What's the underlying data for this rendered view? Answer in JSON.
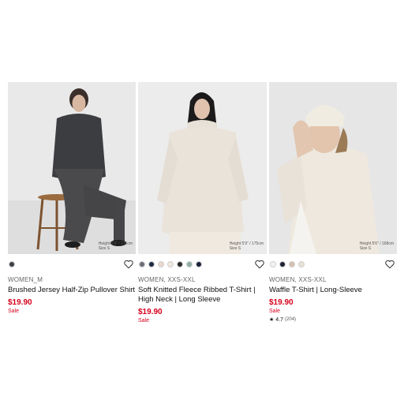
{
  "products": [
    {
      "meta": "WOMEN_M",
      "name": "Brushed Jersey Half-Zip Pullover Shirt",
      "price": "$19.90",
      "sale": "Sale",
      "model_note": "Height 5'9\" / 175cm\nSize S",
      "swatches": [
        "#3b3f45"
      ],
      "rating": null
    },
    {
      "meta": "WOMEN, XXS-XXL",
      "name": "Soft Knitted Fleece Ribbed T-Shirt | High Neck | Long Sleeve",
      "price": "$19.90",
      "sale": "Sale",
      "model_note": "Height 5'9\" / 175cm\nSize S",
      "swatches": [
        "#6b6f76",
        "#1d2a44",
        "#ead8cc",
        "#efe9e0",
        "#2b2b2b",
        "#8fb0a4",
        "#1a1f3a"
      ],
      "rating": null
    },
    {
      "meta": "WOMEN, XXS-XXL",
      "name": "Waffle T-Shirt | Long-Sleeve",
      "price": "$19.90",
      "sale": "Sale",
      "model_note": "Height 5'6\" / 168cm\nSize S",
      "swatches": [
        "#f4f2ee",
        "#1d2233",
        "#d8bfb0",
        "#e8e2d6"
      ],
      "rating": {
        "score": "4.7",
        "count": "(204)"
      }
    }
  ],
  "icons": {
    "wishlist": "heart-outline-icon",
    "rating": "star-icon"
  }
}
